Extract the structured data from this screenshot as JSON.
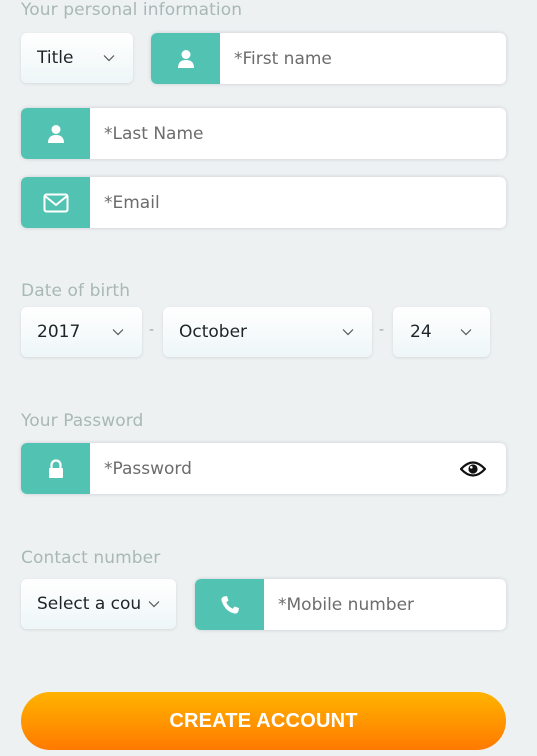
{
  "personal": {
    "label": "Your personal information",
    "title_select": {
      "value": "Title"
    },
    "first_name": {
      "placeholder": "*First name",
      "value": "",
      "icon": "user-icon"
    },
    "last_name": {
      "placeholder": "*Last Name",
      "value": "",
      "icon": "user-icon"
    },
    "email": {
      "placeholder": "*Email",
      "value": "",
      "icon": "envelope-icon"
    }
  },
  "dob": {
    "label": "Date of birth",
    "year": "2017",
    "month": "October",
    "day": "24",
    "separator": "-"
  },
  "password": {
    "label": "Your Password",
    "field": {
      "placeholder": "*Password",
      "value": "",
      "icon": "lock-icon"
    },
    "toggle_icon": "eye-icon"
  },
  "contact": {
    "label": "Contact number",
    "country_select": {
      "value": "Select a country"
    },
    "mobile": {
      "placeholder": "*Mobile number",
      "value": "",
      "icon": "phone-icon"
    }
  },
  "submit": {
    "label": "CREATE ACCOUNT"
  },
  "colors": {
    "accent": "#52c3b3",
    "button_top": "#ffb300",
    "button_bottom": "#ff7a00",
    "background": "#edf1f2",
    "label": "#a9b8b5"
  }
}
